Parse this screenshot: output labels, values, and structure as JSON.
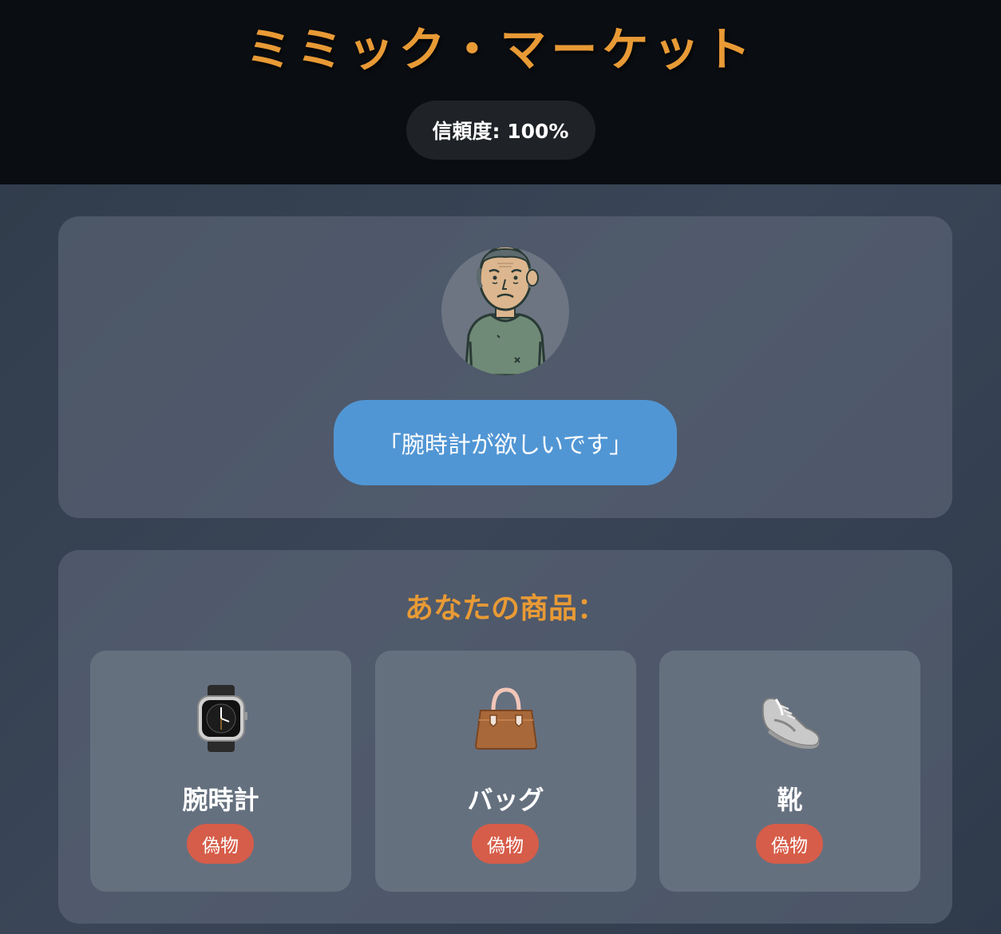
{
  "header": {
    "title": "ミミック・マーケット",
    "trust_label": "信頼度: 100%"
  },
  "customer": {
    "avatar_icon": "old-man-avatar-icon",
    "speech": "「腕時計が欲しいです」"
  },
  "goods": {
    "title": "あなたの商品：",
    "items": [
      {
        "name": "腕時計",
        "icon": "watch-icon",
        "badge": "偽物"
      },
      {
        "name": "バッグ",
        "icon": "handbag-icon",
        "badge": "偽物"
      },
      {
        "name": "靴",
        "icon": "sneaker-icon",
        "badge": "偽物"
      }
    ]
  },
  "colors": {
    "accent": "#e89a35",
    "speech_bubble": "#5196d4",
    "fake_badge": "#d65d49",
    "header_bg": "#0a0d11"
  }
}
